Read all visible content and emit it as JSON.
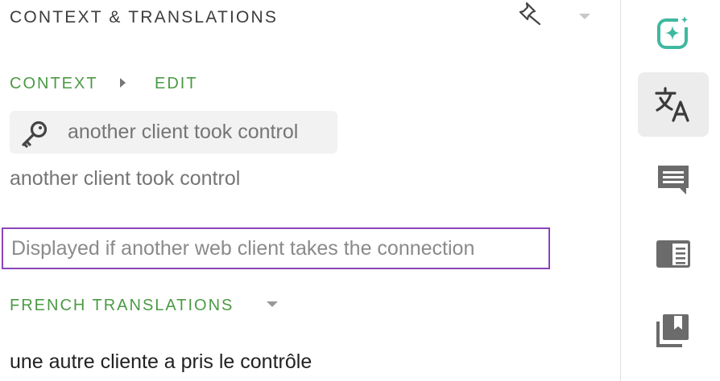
{
  "header": {
    "title": "CONTEXT & TRANSLATIONS"
  },
  "context": {
    "label": "CONTEXT",
    "edit_label": "EDIT",
    "key_name": "another client took control",
    "source_text": "another client took control",
    "description": "Displayed if another web client takes the connection"
  },
  "translations": {
    "label": "FRENCH TRANSLATIONS",
    "value": "une autre cliente a pris le contrôle"
  },
  "sidebar": {
    "items": [
      {
        "icon": "ai-sparkle-icon",
        "active": false
      },
      {
        "icon": "translate-icon",
        "active": true
      },
      {
        "icon": "comment-icon",
        "active": false
      },
      {
        "icon": "glossary-icon",
        "active": false
      },
      {
        "icon": "bookmarks-icon",
        "active": false
      }
    ]
  },
  "colors": {
    "accent_green": "#4b9a45",
    "focus_purple": "#8c44b8",
    "ai_teal": "#3fb8a0"
  }
}
